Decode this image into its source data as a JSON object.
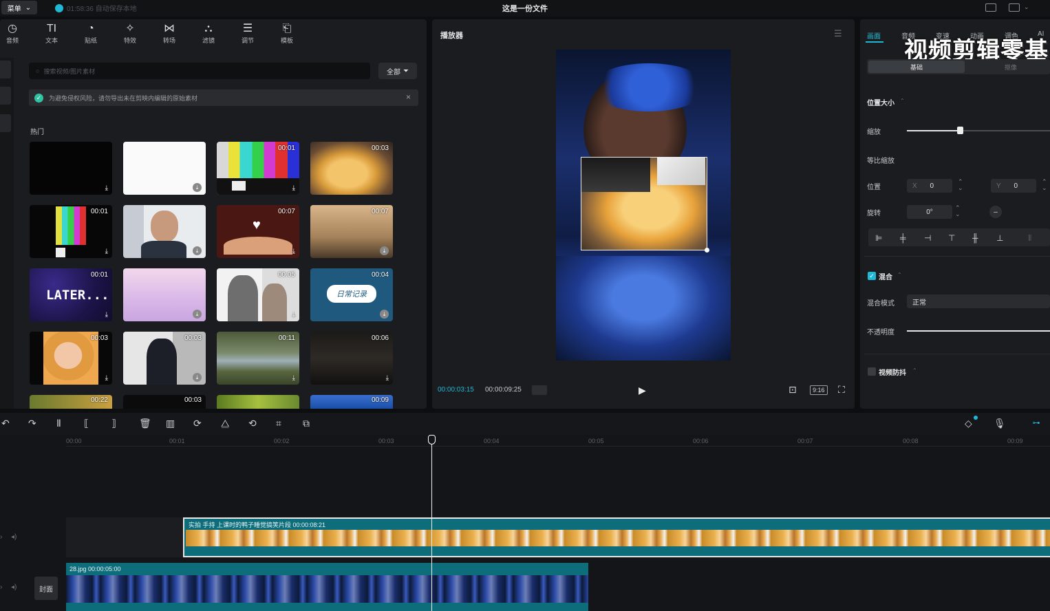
{
  "titlebar": {
    "menu_label": "菜单",
    "autosave": "01:58:36 自动保存本地",
    "document_title": "这是一份文件"
  },
  "media_toolbar": {
    "items": [
      {
        "icon": "audio-icon",
        "glyph": "◷",
        "label": "音频"
      },
      {
        "icon": "text-icon",
        "glyph": "TI",
        "label": "文本"
      },
      {
        "icon": "sticker-icon",
        "glyph": "◔",
        "label": "贴纸"
      },
      {
        "icon": "effects-icon",
        "glyph": "✧",
        "label": "特效"
      },
      {
        "icon": "transition-icon",
        "glyph": "⋈",
        "label": "转场"
      },
      {
        "icon": "filter-icon",
        "glyph": "⛬",
        "label": "滤镜"
      },
      {
        "icon": "adjust-icon",
        "glyph": "☰",
        "label": "调节"
      },
      {
        "icon": "template-icon",
        "glyph": "⎗",
        "label": "模板"
      }
    ]
  },
  "search": {
    "placeholder": "搜索视频/图片素材",
    "filter_label": "全部"
  },
  "notice": "为避免侵权风险，请勿导出未在剪映内编辑的原始素材",
  "section_label": "热门",
  "library": [
    {
      "duration": "",
      "dl": "⤓"
    },
    {
      "duration": "",
      "dl": "⤓"
    },
    {
      "duration": "00:01",
      "dl": "⤓"
    },
    {
      "duration": "00:03",
      "dl": ""
    },
    {
      "duration": "00:01",
      "dl": "⤓"
    },
    {
      "duration": "",
      "dl": "⤓"
    },
    {
      "duration": "00:07",
      "dl": "⤓"
    },
    {
      "duration": "00:07",
      "dl": "⤓"
    },
    {
      "duration": "00:01",
      "dl": "⤓",
      "text": "LATER..."
    },
    {
      "duration": "",
      "dl": "⤓"
    },
    {
      "duration": "00:05",
      "dl": "⤓"
    },
    {
      "duration": "00:04",
      "dl": "⤓",
      "text": "日常记录"
    },
    {
      "duration": "00:03",
      "dl": "⤓"
    },
    {
      "duration": "00:03",
      "dl": "⤓"
    },
    {
      "duration": "00:11",
      "dl": "⤓"
    },
    {
      "duration": "00:06",
      "dl": "⤓"
    },
    {
      "duration": "00:22",
      "dl": ""
    },
    {
      "duration": "00:03",
      "dl": ""
    },
    {
      "duration": "",
      "dl": ""
    },
    {
      "duration": "00:09",
      "dl": ""
    }
  ],
  "player": {
    "title": "播放器",
    "current_time": "00:00:03:15",
    "total_time": "00:00:09:25",
    "ratio": "9:16"
  },
  "properties": {
    "tabs": [
      "画面",
      "音频",
      "变速",
      "动画",
      "调色",
      "AI"
    ],
    "active_tab": "画面",
    "watermark": "视频剪辑零基",
    "subtabs": [
      "基础",
      "抠像"
    ],
    "section_position_size": "位置大小",
    "scale_label": "缩放",
    "scale_value": 0.55,
    "uniform_scale_label": "等比缩放",
    "position_label": "位置",
    "x_label": "X",
    "x_value": "0",
    "y_label": "Y",
    "y_value": "0",
    "rotate_label": "旋转",
    "rotate_value": "0°",
    "blend_label": "混合",
    "blend_mode_label": "混合模式",
    "blend_mode_value": "正常",
    "opacity_label": "不透明度",
    "stabilize_label": "视频防抖",
    "accent": "#1fb8d6"
  },
  "timeline": {
    "ticks": [
      "00:00",
      "00:01",
      "00:02",
      "00:03",
      "00:04",
      "00:05",
      "00:06",
      "00:07",
      "00:08",
      "00:09"
    ],
    "clip1_label": "实拍 手持 上课时的鸭子睡觉搞笑片段   00:00:08:21",
    "clip2_label": "28.jpg   00:00:05:00",
    "cover_label": "封面"
  }
}
